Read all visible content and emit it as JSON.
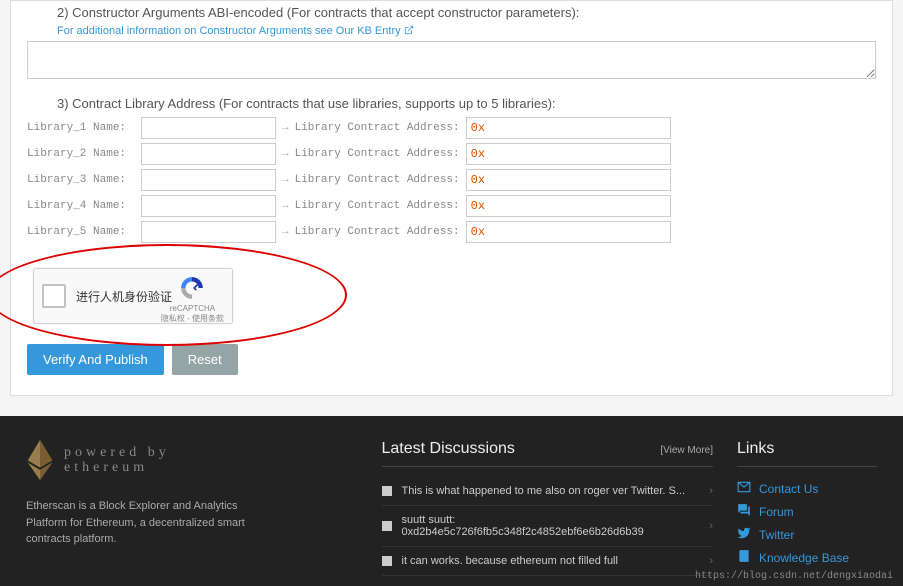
{
  "section2": {
    "title": "2) Constructor Arguments ABI-encoded (For contracts that accept constructor parameters):",
    "kb_link": "For additional information on Constructor Arguments see Our KB Entry"
  },
  "section3": {
    "title": "3) Contract Library Address (For contracts that use libraries, supports up to 5 libraries):",
    "rows": [
      {
        "name_label": "Library_1 Name:",
        "addr_label": "Library Contract Address:",
        "addr_value": "0x"
      },
      {
        "name_label": "Library_2 Name:",
        "addr_label": "Library Contract Address:",
        "addr_value": "0x"
      },
      {
        "name_label": "Library_3 Name:",
        "addr_label": "Library Contract Address:",
        "addr_value": "0x"
      },
      {
        "name_label": "Library_4 Name:",
        "addr_label": "Library Contract Address:",
        "addr_value": "0x"
      },
      {
        "name_label": "Library_5 Name:",
        "addr_label": "Library Contract Address:",
        "addr_value": "0x"
      }
    ]
  },
  "recaptcha": {
    "text": "进行人机身份验证",
    "brand": "reCAPTCHA",
    "privacy": "隐私权 - 使用条款"
  },
  "buttons": {
    "verify": "Verify And Publish",
    "reset": "Reset"
  },
  "footer": {
    "logo_line1": "powered by",
    "logo_line2": "ethereum",
    "description": "Etherscan is a Block Explorer and Analytics Platform for Ethereum, a decentralized smart contracts platform.",
    "discussions": {
      "heading": "Latest Discussions",
      "view_more": "[View More]",
      "items": [
        "This is what happened to me also on roger ver Twitter. S...",
        "suutt suutt: 0xd2b4e5c726f6fb5c348f2c4852ebf6e6b26d6b39",
        "it can works. because ethereum not filled full"
      ]
    },
    "links": {
      "heading": "Links",
      "items": [
        {
          "icon": "mail",
          "label": "Contact Us"
        },
        {
          "icon": "forum",
          "label": "Forum"
        },
        {
          "icon": "twitter",
          "label": "Twitter"
        },
        {
          "icon": "book",
          "label": "Knowledge Base"
        }
      ]
    },
    "watermark": "https://blog.csdn.net/dengxiaodai"
  }
}
